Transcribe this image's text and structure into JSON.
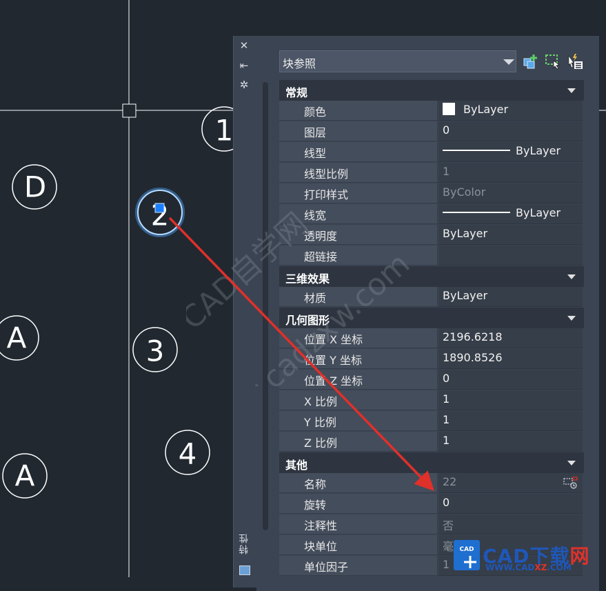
{
  "canvas": {
    "bubbles": [
      {
        "label": "1"
      },
      {
        "label": "D"
      },
      {
        "label": "2"
      },
      {
        "label": "A"
      },
      {
        "label": "3"
      },
      {
        "label": "4"
      },
      {
        "label": "A"
      }
    ],
    "arrow_color": "#e0302a",
    "selection_color": "#4da3ff"
  },
  "palette": {
    "title": "特性",
    "strip_icons": [
      "close-icon",
      "auto-hide-icon",
      "settings-icon"
    ],
    "selector": {
      "value": "块参照"
    },
    "tool_icons": [
      "toggle-pickadd-icon",
      "select-objects-icon",
      "quick-select-icon"
    ],
    "categories": [
      {
        "label": "常规",
        "rows": [
          {
            "name": "颜色",
            "value": "ByLayer",
            "kind": "color"
          },
          {
            "name": "图层",
            "value": "0"
          },
          {
            "name": "线型",
            "value": "ByLayer",
            "kind": "linetype"
          },
          {
            "name": "线型比例",
            "value": "1",
            "dim": true
          },
          {
            "name": "打印样式",
            "value": "ByColor",
            "dim": true
          },
          {
            "name": "线宽",
            "value": "ByLayer",
            "kind": "linetype"
          },
          {
            "name": "透明度",
            "value": "ByLayer"
          },
          {
            "name": "超链接",
            "value": ""
          }
        ]
      },
      {
        "label": "三维效果",
        "rows": [
          {
            "name": "材质",
            "value": "ByLayer"
          }
        ]
      },
      {
        "label": "几何图形",
        "rows": [
          {
            "name": "位置 X 坐标",
            "value": "2196.6218"
          },
          {
            "name": "位置 Y 坐标",
            "value": "1890.8526"
          },
          {
            "name": "位置 Z 坐标",
            "value": "0"
          },
          {
            "name": "X 比例",
            "value": "1"
          },
          {
            "name": "Y 比例",
            "value": "1"
          },
          {
            "name": "Z 比例",
            "value": "1"
          }
        ]
      },
      {
        "label": "其他",
        "rows": [
          {
            "name": "名称",
            "value": "22",
            "dim": true,
            "kind": "pick"
          },
          {
            "name": "旋转",
            "value": "0"
          },
          {
            "name": "注释性",
            "value": "否",
            "dim": true
          },
          {
            "name": "块单位",
            "value": "毫",
            "dim": true
          },
          {
            "name": "单位因子",
            "value": "1",
            "dim": true
          }
        ]
      }
    ]
  },
  "watermark": {
    "line1": "CAD自学网",
    "line2": "www.cadzxw.com"
  },
  "logo": {
    "badge": "CAD",
    "main_prefix": "CAD下载",
    "main_suffix": "网",
    "sub_prefix": "WWW.CAD",
    "sub_mid": "XZ",
    "sub_suffix": ".COM"
  }
}
